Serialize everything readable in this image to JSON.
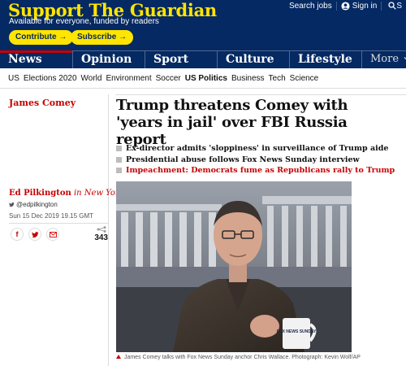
{
  "header": {
    "support_title": "Support The Guardian",
    "support_subtitle": "Available for everyone, funded by readers",
    "contribute_label": "Contribute →",
    "subscribe_label": "Subscribe →",
    "search_jobs": "Search jobs",
    "sign_in": "Sign in",
    "search_label": "S"
  },
  "nav": {
    "items": [
      "News",
      "Opinion",
      "Sport",
      "Culture",
      "Lifestyle"
    ],
    "more_label": "More"
  },
  "subnav": {
    "items": [
      "US",
      "Elections 2020",
      "World",
      "Environment",
      "Soccer",
      "US Politics",
      "Business",
      "Tech",
      "Science"
    ],
    "active": "US Politics"
  },
  "article": {
    "section": "James Comey",
    "headline": "Trump threatens Comey with 'years in jail' over FBI Russia report",
    "standfirst": [
      "Ex-director admits 'sloppiness' in surveillance of Trump aide",
      "Presidential abuse follows Fox News Sunday interview"
    ],
    "related_link": "Impeachment: Democrats fume as Republicans rally to Trump",
    "byline_name": "Ed Pilkington",
    "byline_location": "in New York",
    "twitter_handle": "@edpilkington",
    "dateline": "Sun 15 Dec 2019 19.15 GMT",
    "share_count": "343",
    "caption": "James Comey talks with Fox News Sunday anchor Chris Wallace. Photograph: Kevin Wolf/AP",
    "mug_text": "FOX NEWS SUNDAY"
  },
  "colors": {
    "brand_blue": "#052962",
    "highlight_yellow": "#ffe500",
    "news_red": "#c70000"
  }
}
